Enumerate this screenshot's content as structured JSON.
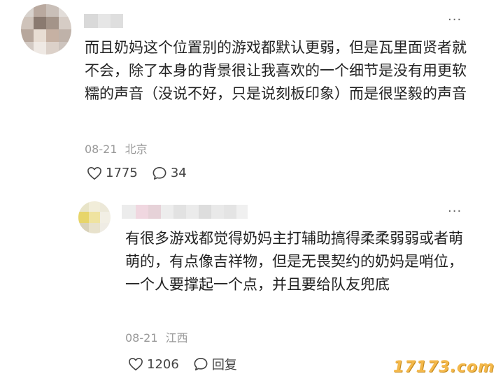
{
  "comments": [
    {
      "text": "而且奶妈这个位置别的游戏都默认更弱，但是瓦里面贤者就不会，除了本身的背景很让我喜欢的一个细节是没有用更软糯的声音（没说不好，只是说刻板印象）而是很坚毅的声音",
      "date": "08-21",
      "location": "北京",
      "likes": "1775",
      "replies": "34",
      "more": "···"
    },
    {
      "text": "有很多游戏都觉得奶妈主打辅助搞得柔柔弱弱或者萌萌的，有点像吉祥物，但是无畏契约的奶妈是哨位，一个人要撑起一个点，并且要给队友兜底",
      "date": "08-21",
      "location": "江西",
      "likes": "1206",
      "reply_label": "回复",
      "more": "···"
    }
  ],
  "watermark": "17173.com",
  "colors": {
    "text": "#222222",
    "meta": "#999999",
    "icon": "#444444",
    "watermark": "#f4b84a"
  }
}
